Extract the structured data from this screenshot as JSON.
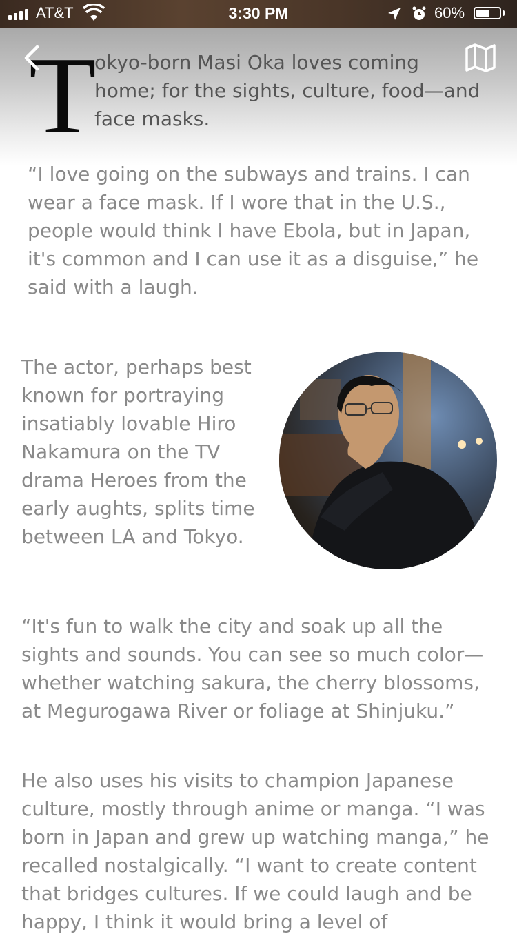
{
  "status_bar": {
    "carrier": "AT&T",
    "time": "3:30 PM",
    "battery_percent": "60%",
    "battery_level": 0.6
  },
  "header": {
    "back_icon": "chevron-left-icon",
    "map_icon": "map-icon"
  },
  "article": {
    "drop_cap": "T",
    "intro": "okyo-born Masi Oka loves coming home; for the sights, culture, food—and face masks.",
    "paragraphs": [
      "“I love going on the subways and trains. I can wear a face mask. If I wore that in the U.S., people would think I have Ebola, but in Japan, it's common and I can use it as a disguise,” he said with a laugh.",
      "The actor, perhaps best known for portraying insatiably lovable Hiro Nakamura on the TV drama Heroes from the early aughts, splits time between LA and Tokyo.",
      "“It's fun to walk the city and soak up all the sights and sounds. You can see so much color—whether watching sakura, the cherry blossoms, at Megurogawa River or foliage at Shinjuku.”",
      "He also uses his visits to champion Japanese culture, mostly through anime or manga. “I was born in Japan and grew up watching manga,” he recalled nostalgically.  “I want to create content that bridges cultures. If we could laugh and be happy, I think it would bring a level of"
    ]
  }
}
